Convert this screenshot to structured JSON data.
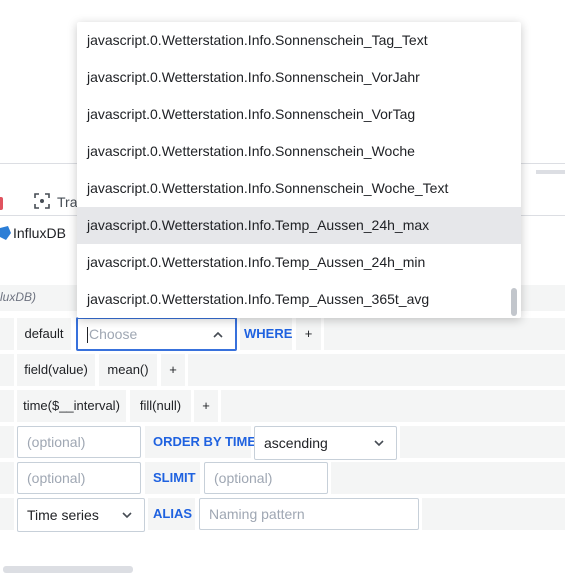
{
  "tabs": {
    "active_tab_label": "",
    "second_tab_label": "Tra"
  },
  "datasource": {
    "name": "InfluxDB"
  },
  "query_hint": "luxDB)",
  "rows": {
    "from": {
      "policy": "default",
      "measurement_placeholder": "Choose",
      "where_label": "WHERE",
      "add": "+"
    },
    "select": {
      "field": "field(value)",
      "agg": "mean()",
      "add": "+"
    },
    "groupby": {
      "time": "time($__interval)",
      "fill": "fill(null)",
      "add": "+"
    },
    "limit": {
      "placeholder": "(optional)",
      "order_label": "ORDER BY TIME",
      "order_value": "ascending"
    },
    "slimit": {
      "placeholder": "(optional)",
      "slimit_label": "SLIMIT",
      "slimit_placeholder": "(optional)"
    },
    "format": {
      "format_value": "Time series",
      "alias_label": "ALIAS",
      "alias_placeholder": "Naming pattern"
    }
  },
  "dropdown": {
    "options": [
      "javascript.0.Wetterstation.Info.Sonnenschein_Tag_Text",
      "javascript.0.Wetterstation.Info.Sonnenschein_VorJahr",
      "javascript.0.Wetterstation.Info.Sonnenschein_VorTag",
      "javascript.0.Wetterstation.Info.Sonnenschein_Woche",
      "javascript.0.Wetterstation.Info.Sonnenschein_Woche_Text",
      "javascript.0.Wetterstation.Info.Temp_Aussen_24h_max",
      "javascript.0.Wetterstation.Info.Temp_Aussen_24h_min",
      "javascript.0.Wetterstation.Info.Temp_Aussen_365t_avg"
    ],
    "highlighted_index": 5
  },
  "colors": {
    "keyword": "#1f62e0",
    "focus_border": "#3871dc",
    "active_tab": "#e0535f"
  }
}
